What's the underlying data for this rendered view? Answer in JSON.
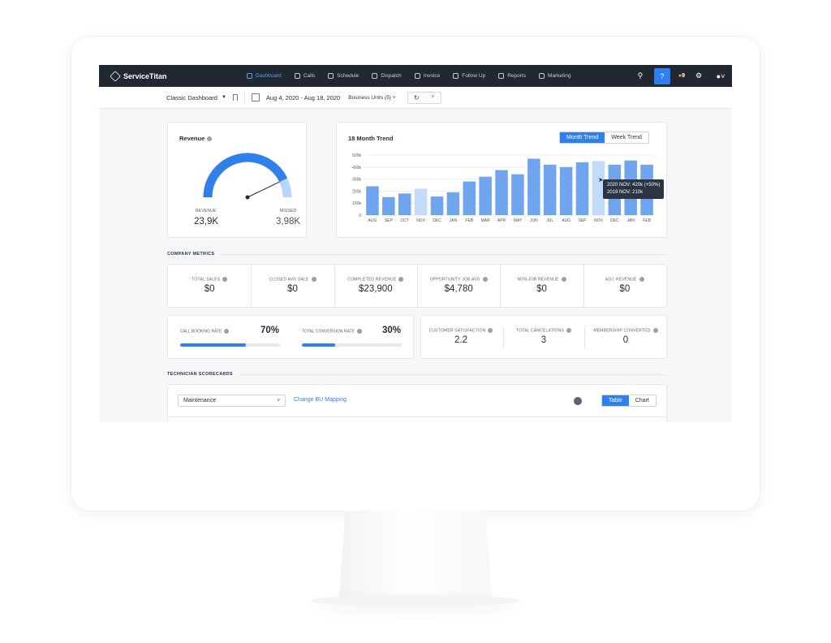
{
  "nav": {
    "logo": "ServiceTitan",
    "items": [
      {
        "label": "Dashboard",
        "icon": "dashboard-icon",
        "active": true
      },
      {
        "label": "Calls",
        "icon": "phone-icon"
      },
      {
        "label": "Schedule",
        "icon": "calendar-icon"
      },
      {
        "label": "Dispatch",
        "icon": "truck-icon"
      },
      {
        "label": "Invoice",
        "icon": "invoice-icon"
      },
      {
        "label": "Follow Up",
        "icon": "flag-icon"
      },
      {
        "label": "Reports",
        "icon": "reports-icon"
      },
      {
        "label": "Marketing",
        "icon": "megaphone-icon"
      }
    ],
    "help": "?",
    "notifications": "9"
  },
  "toolbar": {
    "dashboard": "Classic Dashboard",
    "date_range": "Aug 4, 2020 - Aug 18, 2020",
    "business_units": "Business Units (5)"
  },
  "revenue": {
    "title": "Revenue",
    "revenue_label": "REVENUE",
    "revenue_value": "23,9K",
    "missed_label": "MISSED",
    "missed_value": "3,98K",
    "revenue_fraction": 0.857
  },
  "trend": {
    "title": "18 Month Trend",
    "toggle": [
      "Month Trend",
      "Week Trend"
    ],
    "tooltip": [
      "2020 NOV: 420k (+50%)",
      "2019 NOV: 210k"
    ]
  },
  "chart_data": {
    "type": "bar",
    "categories": [
      "AUG",
      "SEP",
      "OCT",
      "NOV",
      "DEC",
      "JAN",
      "FEB",
      "MAR",
      "APR",
      "MAY",
      "JUN",
      "JUL",
      "AUG",
      "SEP",
      "NOV",
      "DEC",
      "JAN",
      "FEB"
    ],
    "values": [
      240,
      150,
      180,
      220,
      155,
      190,
      280,
      320,
      375,
      340,
      470,
      420,
      400,
      440,
      450,
      420,
      455,
      420
    ],
    "highlight": [
      3,
      14
    ],
    "yticks": [
      "0",
      "100k",
      "200k",
      "300k",
      "400k",
      "500k"
    ],
    "ylim": [
      0,
      500
    ],
    "colors": {
      "bar": "#6fa4ef",
      "highlight": "#c2dbfa"
    }
  },
  "company_metrics": {
    "label": "COMPANY METRICS",
    "items": [
      {
        "label": "TOTAL SALES",
        "value": "$0"
      },
      {
        "label": "CLOSED AVG SALE",
        "value": "$0"
      },
      {
        "label": "COMPLETED REVENUE",
        "value": "$23,900"
      },
      {
        "label": "OPPORTUNITY JOB AVG",
        "value": "$4,780"
      },
      {
        "label": "NON-JOB REVENUE",
        "value": "$0"
      },
      {
        "label": "ADJ. REVENUE",
        "value": "$0"
      }
    ]
  },
  "rates": {
    "call_booking": {
      "label": "CALL BOOKING RATE",
      "value": "70%",
      "fill": 0.66
    },
    "total_conversion": {
      "label": "TOTAL CONVERSION RATE",
      "value": "30%",
      "fill": 0.33
    }
  },
  "satisfaction": [
    {
      "label": "CUSTOMER SATISFACTION",
      "value": "2.2"
    },
    {
      "label": "TOTAL CANCELATIONS",
      "value": "3"
    },
    {
      "label": "MEMBERSHIP CONVERTED",
      "value": "0"
    }
  ],
  "scorecards": {
    "label": "TECHNICIAN SCORECARDS",
    "select": "Maintenance",
    "link": "Change BU Mapping",
    "toggle": [
      "Table",
      "Chart"
    ]
  }
}
